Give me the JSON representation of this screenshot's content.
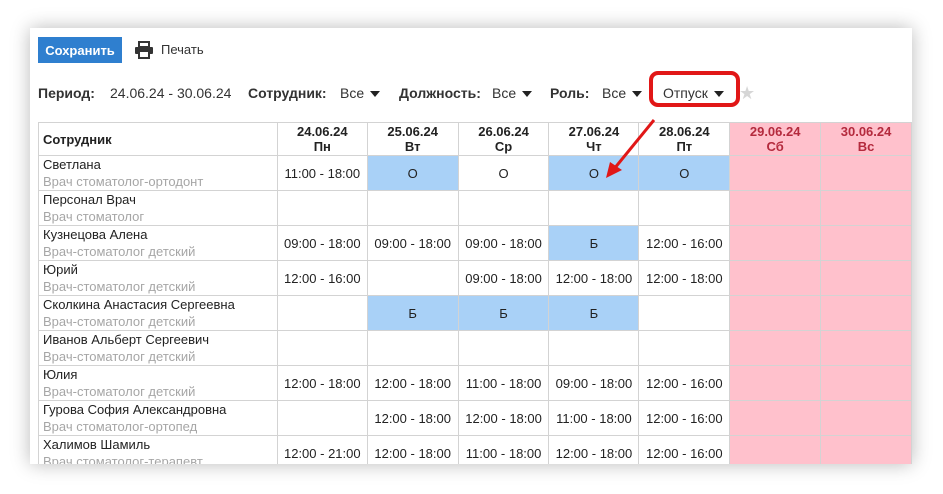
{
  "toolbar": {
    "save_label": "Сохранить",
    "print_label": "Печать"
  },
  "filters": {
    "period_label": "Период:",
    "period_value": "24.06.24 - 30.06.24",
    "employee_label": "Сотрудник:",
    "employee_value": "Все",
    "position_label": "Должность:",
    "position_value": "Все",
    "role_label": "Роль:",
    "role_value": "Все",
    "absence_value": "Отпуск"
  },
  "colors": {
    "save_button": "#2f7fcf",
    "absence_cell": "#a9d1f7",
    "weekend": "#ffc1cc",
    "highlight": "#e11717"
  },
  "table": {
    "employee_header": "Сотрудник",
    "days": [
      {
        "date": "24.06.24",
        "dow": "Пн",
        "weekend": false
      },
      {
        "date": "25.06.24",
        "dow": "Вт",
        "weekend": false
      },
      {
        "date": "26.06.24",
        "dow": "Ср",
        "weekend": false
      },
      {
        "date": "27.06.24",
        "dow": "Чт",
        "weekend": false
      },
      {
        "date": "28.06.24",
        "dow": "Пт",
        "weekend": false
      },
      {
        "date": "29.06.24",
        "dow": "Сб",
        "weekend": true
      },
      {
        "date": "30.06.24",
        "dow": "Вс",
        "weekend": true
      }
    ],
    "rows": [
      {
        "name": "Светлана",
        "role": "Врач стоматолог-ортодонт",
        "cells": [
          {
            "v": "11:00 - 18:00"
          },
          {
            "v": "О",
            "mark": true
          },
          {
            "v": "О"
          },
          {
            "v": "О",
            "mark": true
          },
          {
            "v": "О",
            "mark": true
          },
          {
            "v": ""
          },
          {
            "v": ""
          }
        ]
      },
      {
        "name": "Персонал Врач",
        "role": "Врач стоматолог",
        "cells": [
          {
            "v": ""
          },
          {
            "v": ""
          },
          {
            "v": ""
          },
          {
            "v": ""
          },
          {
            "v": ""
          },
          {
            "v": ""
          },
          {
            "v": ""
          }
        ]
      },
      {
        "name": "Кузнецова Алена",
        "role": "Врач-стоматолог детский",
        "cells": [
          {
            "v": "09:00 - 18:00"
          },
          {
            "v": "09:00 - 18:00"
          },
          {
            "v": "09:00 - 18:00"
          },
          {
            "v": "Б",
            "mark": true
          },
          {
            "v": "12:00 - 16:00"
          },
          {
            "v": ""
          },
          {
            "v": ""
          }
        ]
      },
      {
        "name": "Юрий",
        "role": "Врач-стоматолог детский",
        "cells": [
          {
            "v": "12:00 - 16:00"
          },
          {
            "v": ""
          },
          {
            "v": "09:00 - 18:00"
          },
          {
            "v": "12:00 - 18:00"
          },
          {
            "v": "12:00 - 18:00"
          },
          {
            "v": ""
          },
          {
            "v": ""
          }
        ]
      },
      {
        "name": "Сколкина Анастасия Сергеевна",
        "role": "Врач-стоматолог детский",
        "cells": [
          {
            "v": ""
          },
          {
            "v": "Б",
            "mark": true
          },
          {
            "v": "Б",
            "mark": true
          },
          {
            "v": "Б",
            "mark": true
          },
          {
            "v": ""
          },
          {
            "v": ""
          },
          {
            "v": ""
          }
        ]
      },
      {
        "name": "Иванов Альберт Сергеевич",
        "role": "Врач-стоматолог детский",
        "cells": [
          {
            "v": ""
          },
          {
            "v": ""
          },
          {
            "v": ""
          },
          {
            "v": ""
          },
          {
            "v": ""
          },
          {
            "v": ""
          },
          {
            "v": ""
          }
        ]
      },
      {
        "name": "Юлия",
        "role": "Врач-стоматолог детский",
        "cells": [
          {
            "v": "12:00 - 18:00"
          },
          {
            "v": "12:00 - 18:00"
          },
          {
            "v": "11:00 - 18:00"
          },
          {
            "v": "09:00 - 18:00"
          },
          {
            "v": "12:00 - 16:00"
          },
          {
            "v": ""
          },
          {
            "v": ""
          }
        ]
      },
      {
        "name": "Гурова София Александровна",
        "role": "Врач стоматолог-ортопед",
        "cells": [
          {
            "v": ""
          },
          {
            "v": "12:00 - 18:00"
          },
          {
            "v": "12:00 - 18:00"
          },
          {
            "v": "11:00 - 18:00"
          },
          {
            "v": "12:00 - 16:00"
          },
          {
            "v": ""
          },
          {
            "v": ""
          }
        ]
      },
      {
        "name": "Халимов Шамиль",
        "role": "Врач стоматолог-терапевт",
        "cells": [
          {
            "v": "12:00 - 21:00"
          },
          {
            "v": "12:00 - 18:00"
          },
          {
            "v": "11:00 - 18:00"
          },
          {
            "v": "12:00 - 18:00"
          },
          {
            "v": "12:00 - 16:00"
          },
          {
            "v": ""
          },
          {
            "v": ""
          }
        ]
      }
    ]
  }
}
